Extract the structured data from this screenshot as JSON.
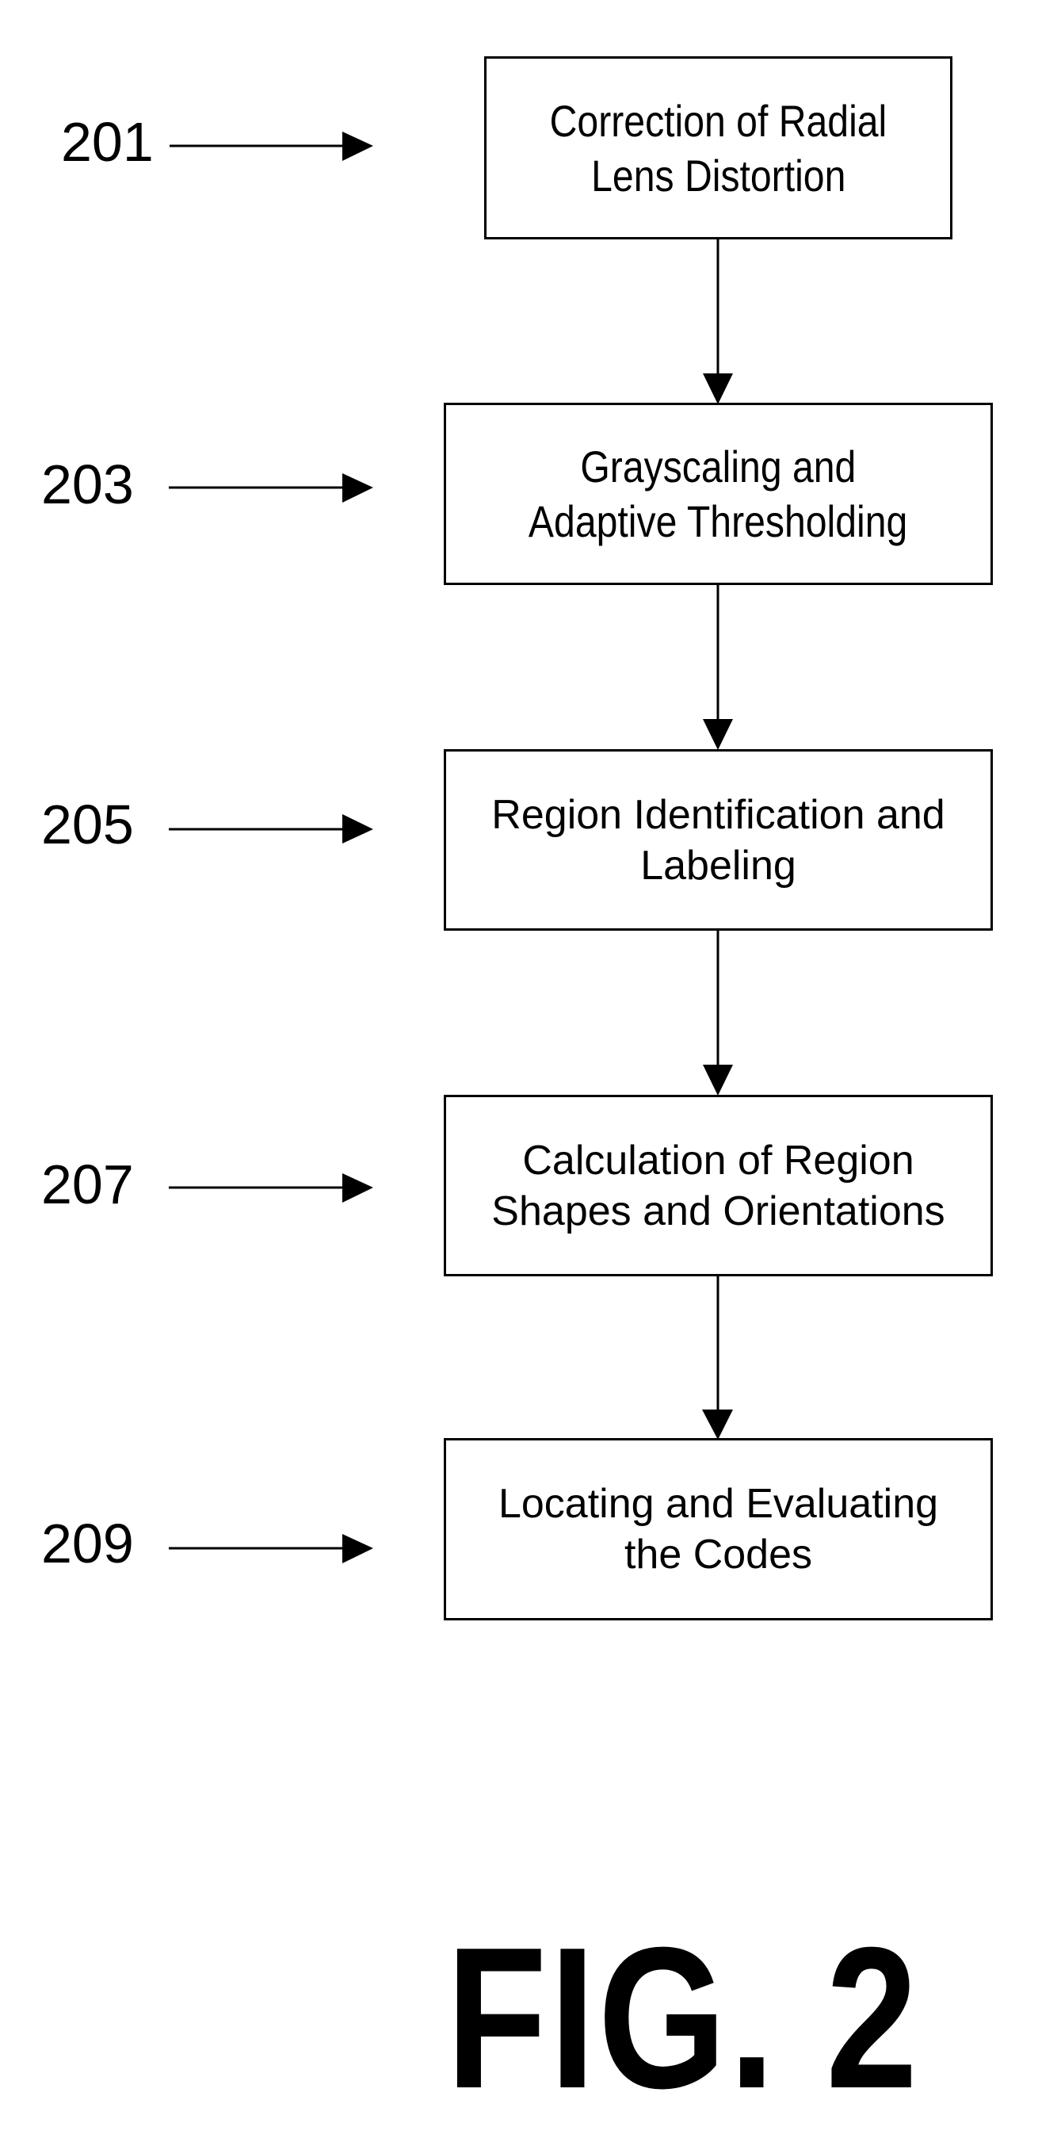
{
  "figure": {
    "title": "FIG. 2",
    "line_color": "#000000",
    "background_color": "#ffffff"
  },
  "steps": [
    {
      "ref": "201",
      "lines": [
        "Correction of Radial",
        "Lens Distortion"
      ]
    },
    {
      "ref": "203",
      "lines": [
        "Grayscaling and",
        "Adaptive Thresholding"
      ]
    },
    {
      "ref": "205",
      "lines": [
        "Region Identification and",
        "Labeling"
      ]
    },
    {
      "ref": "207",
      "lines": [
        "Calculation of Region",
        "Shapes and Orientations"
      ]
    },
    {
      "ref": "209",
      "lines": [
        "Locating and Evaluating",
        "the Codes"
      ]
    }
  ],
  "connections": [
    {
      "from": "201",
      "to": "203"
    },
    {
      "from": "203",
      "to": "205"
    },
    {
      "from": "205",
      "to": "207"
    },
    {
      "from": "207",
      "to": "209"
    }
  ]
}
